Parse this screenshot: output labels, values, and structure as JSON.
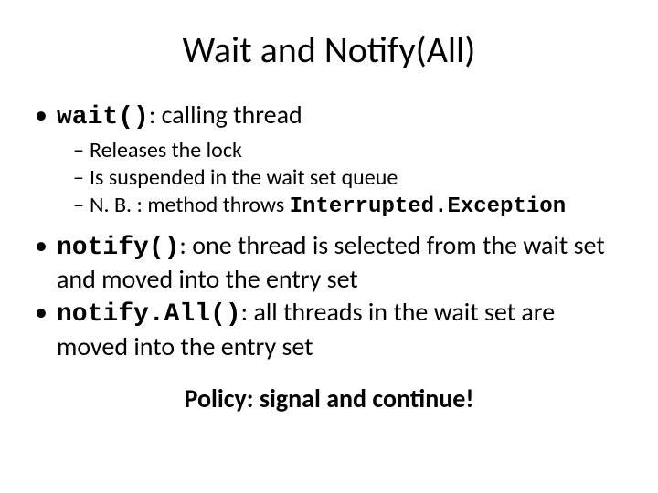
{
  "title": "Wait and Notify(All)",
  "b1": {
    "code": "wait()",
    "rest": ": calling thread"
  },
  "s1": "Releases the lock",
  "s2": "Is suspended in the wait set queue",
  "s3": {
    "pre": "N. B. : method throws ",
    "code": "Interrupted.Exception"
  },
  "b2": {
    "code": "notify()",
    "rest": ":  one thread is selected from the wait set and moved into the entry set"
  },
  "b3": {
    "code": "notify.All()",
    "rest": ": all threads in the wait set are moved into the entry set"
  },
  "policy": "Policy: signal and continue!"
}
